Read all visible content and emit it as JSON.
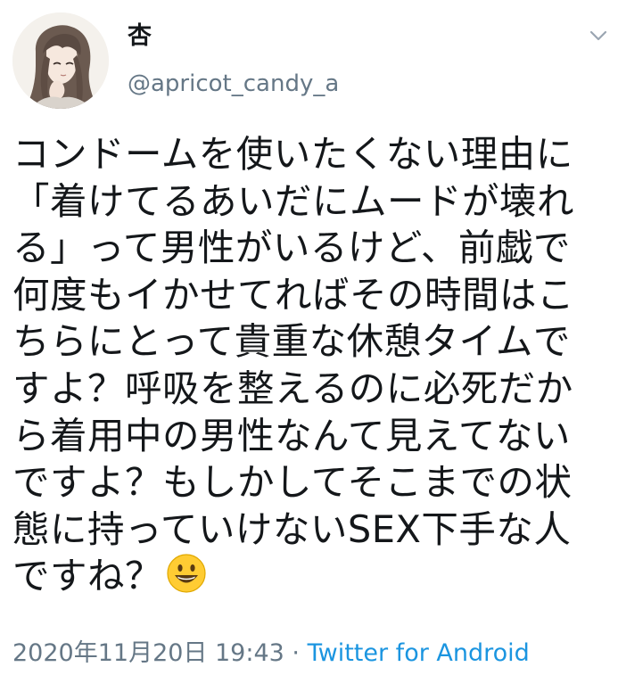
{
  "user": {
    "display_name": "杏",
    "handle": "@apricot_candy_a"
  },
  "tweet": {
    "lines": [
      "コンドームを使いたくない理由に",
      "「着けてるあいだにムードが壊れ",
      "る」って男性がいるけど、前戯で",
      "何度もイかせてればその時間はこ",
      "ちらにとって貴重な休憩タイムで",
      "すよ？呼吸を整えるのに必死だか",
      "ら着用中の男性なんて見えてない",
      "ですよ？もしかしてそこまでの状",
      "態に持っていけないSEX下手な人",
      "ですね？"
    ],
    "emoji": "grinning-face",
    "timestamp": "2020年11月20日 19:43",
    "separator": "·",
    "source": "Twitter for Android"
  },
  "icons": {
    "menu": "chevron-down-icon",
    "avatar": "illustrated-girl-avatar"
  },
  "colors": {
    "text": "#14171a",
    "secondary": "#657786",
    "link": "#1b95e0",
    "emoji_face": "#ffcc33",
    "background": "#ffffff"
  }
}
